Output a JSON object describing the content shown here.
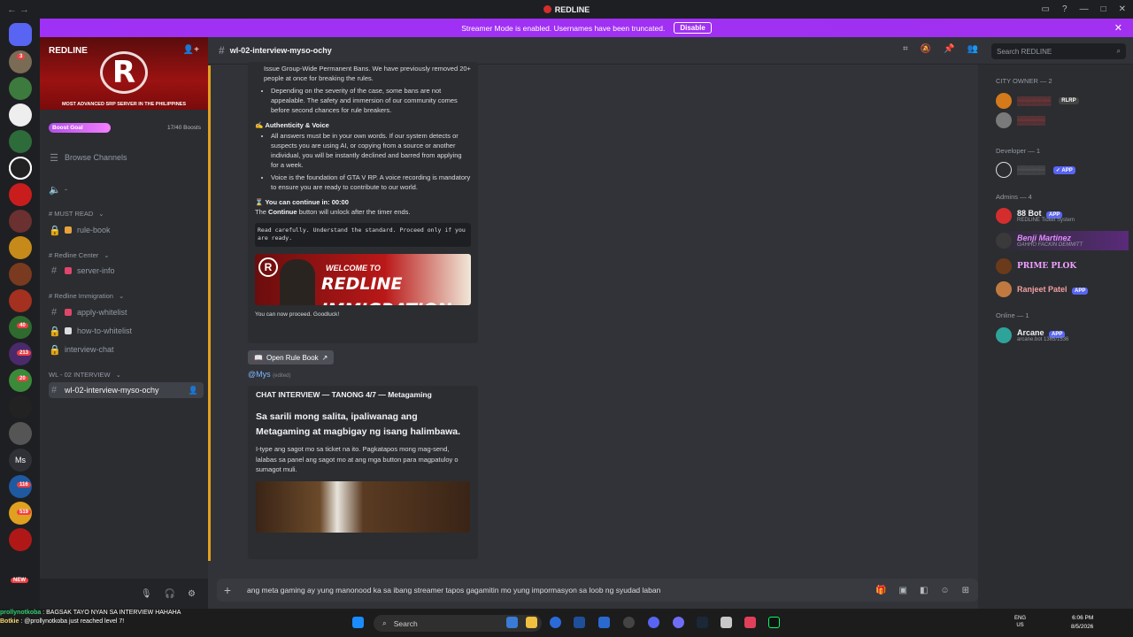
{
  "app": {
    "title": "REDLINE",
    "colors": {
      "accent": "#5865f2",
      "brand_red": "#d42d2d",
      "banner": "#a130f0",
      "online": "#23a55a"
    }
  },
  "banner": {
    "text": "Streamer Mode is enabled. Usernames have been truncated.",
    "disable_label": "Disable"
  },
  "server": {
    "name": "REDLINE",
    "tagline": "MOST ADVANCED SRP SERVER IN THE PHILIPPINES",
    "emblem": "R",
    "boost_goal": "Boost Goal",
    "boosts": "17/40 Boosts",
    "browse": "Browse Channels",
    "server_badges": [
      "3",
      "40",
      "213",
      "20",
      "116",
      "519",
      "NEW"
    ]
  },
  "channels": [
    {
      "kind": "cat",
      "label": "# MUST READ"
    },
    {
      "kind": "ch",
      "label": "rule-book"
    },
    {
      "kind": "cat",
      "label": "# Redline Center"
    },
    {
      "kind": "ch",
      "label": "server-info"
    },
    {
      "kind": "cat",
      "label": "# Redline Immigration"
    },
    {
      "kind": "ch",
      "label": "apply-whitelist"
    },
    {
      "kind": "ch",
      "label": "how-to-whitelist"
    },
    {
      "kind": "ch",
      "label": "interview-chat"
    },
    {
      "kind": "cat",
      "label": "WL - 02 INTERVIEW"
    },
    {
      "kind": "ch",
      "label": "wl-02-interview-myso-ochy"
    }
  ],
  "channel_header": {
    "name": "wl-02-interview-myso-ochy"
  },
  "search": {
    "placeholder": "Search REDLINE"
  },
  "embed1": {
    "bullet1": "Issue Group-Wide Permanent Bans. We have previously removed 20+ people at once for breaking the rules.",
    "bullet2": "Depending on the severity of the case, some bans are not appealable. The safety and immersion of our community comes before second chances for rule breakers.",
    "auth_heading": "Authenticity & Voice",
    "bullet3": "All answers must be in your own words. If our system detects or suspects you are using AI, or copying from a source or another individual, you will be instantly declined and barred from applying for a week.",
    "bullet4": "Voice is the foundation of GTA V RP. A voice recording is mandatory to ensure you are ready to contribute to our world.",
    "timer": "You can continue in: 00:00",
    "continue_pre": "The",
    "continue_bold": "Continue",
    "continue_post": "button will unlock after the timer ends.",
    "code": "Read carefully. Understand the standard. Proceed only if you are ready.",
    "banner_small": "WELCOME TO",
    "banner_big": "REDLINE IMMIGRATION",
    "footer": "You can now proceed. Goodluck!"
  },
  "rule_button": "Open Rule Book",
  "author": {
    "name": "@Mys",
    "edited": "(edited)"
  },
  "embed2": {
    "title": "CHAT INTERVIEW — TANONG 4/7 — Metagaming",
    "question": "Sa sarili mong salita, ipaliwanag ang Metagaming at magbigay ng isang halimbawa.",
    "instruction": "I-type ang sagot mo sa ticket na ito. Pagkatapos mong mag-send, lalabas sa panel ang sagot mo at ang mga button para magpatuloy o sumagot muli."
  },
  "composer": {
    "text": "ang meta gaming ay yung manonood ka sa ibang streamer tapos gagamitin mo yung impormasyon sa loob ng syudad laban"
  },
  "members": {
    "groups": [
      {
        "label": "CITY OWNER — 2"
      },
      {
        "label": "Developer — 1"
      },
      {
        "label": "Admins — 4"
      },
      {
        "label": "Online — 1"
      }
    ],
    "list": [
      {
        "name": "88 Bot",
        "sub": "REDLINE Ticket System",
        "tag": "APP",
        "color": "#f2f3f5",
        "av": "#d42d2d"
      },
      {
        "name": "Benji Martinez",
        "sub": "GAHHO FACKIN DEMMITT",
        "tag": "",
        "color": "#e28cff",
        "av": "#3a3a3a"
      },
      {
        "name": "PRIME PLOK",
        "sub": "",
        "tag": "",
        "color": "#f0a0ff",
        "av": "#6b3a1a"
      },
      {
        "name": "Ranjeet Patel",
        "sub": "",
        "tag": "APP",
        "color": "#f2a0a0",
        "av": "#c07a40"
      },
      {
        "name": "Arcane",
        "sub": "arcane.bot 1365/1536",
        "tag": "APP",
        "color": "#f2f3f5",
        "av": "#2ea39a"
      }
    ],
    "owner_tag": "RLRP"
  },
  "taskbar": {
    "search": "Search",
    "lang1": "ENG",
    "lang2": "US",
    "time": "6:06 PM",
    "date": "8/5/2026"
  },
  "ticker": {
    "line1_name": "prollynotkoba",
    "line1_text": "BAGSAK TAYO NYAN SA INTERVIEW HAHAHA",
    "line2_name": "Botkie",
    "line2_text": "@prollynotkoba just reached level 7!"
  }
}
